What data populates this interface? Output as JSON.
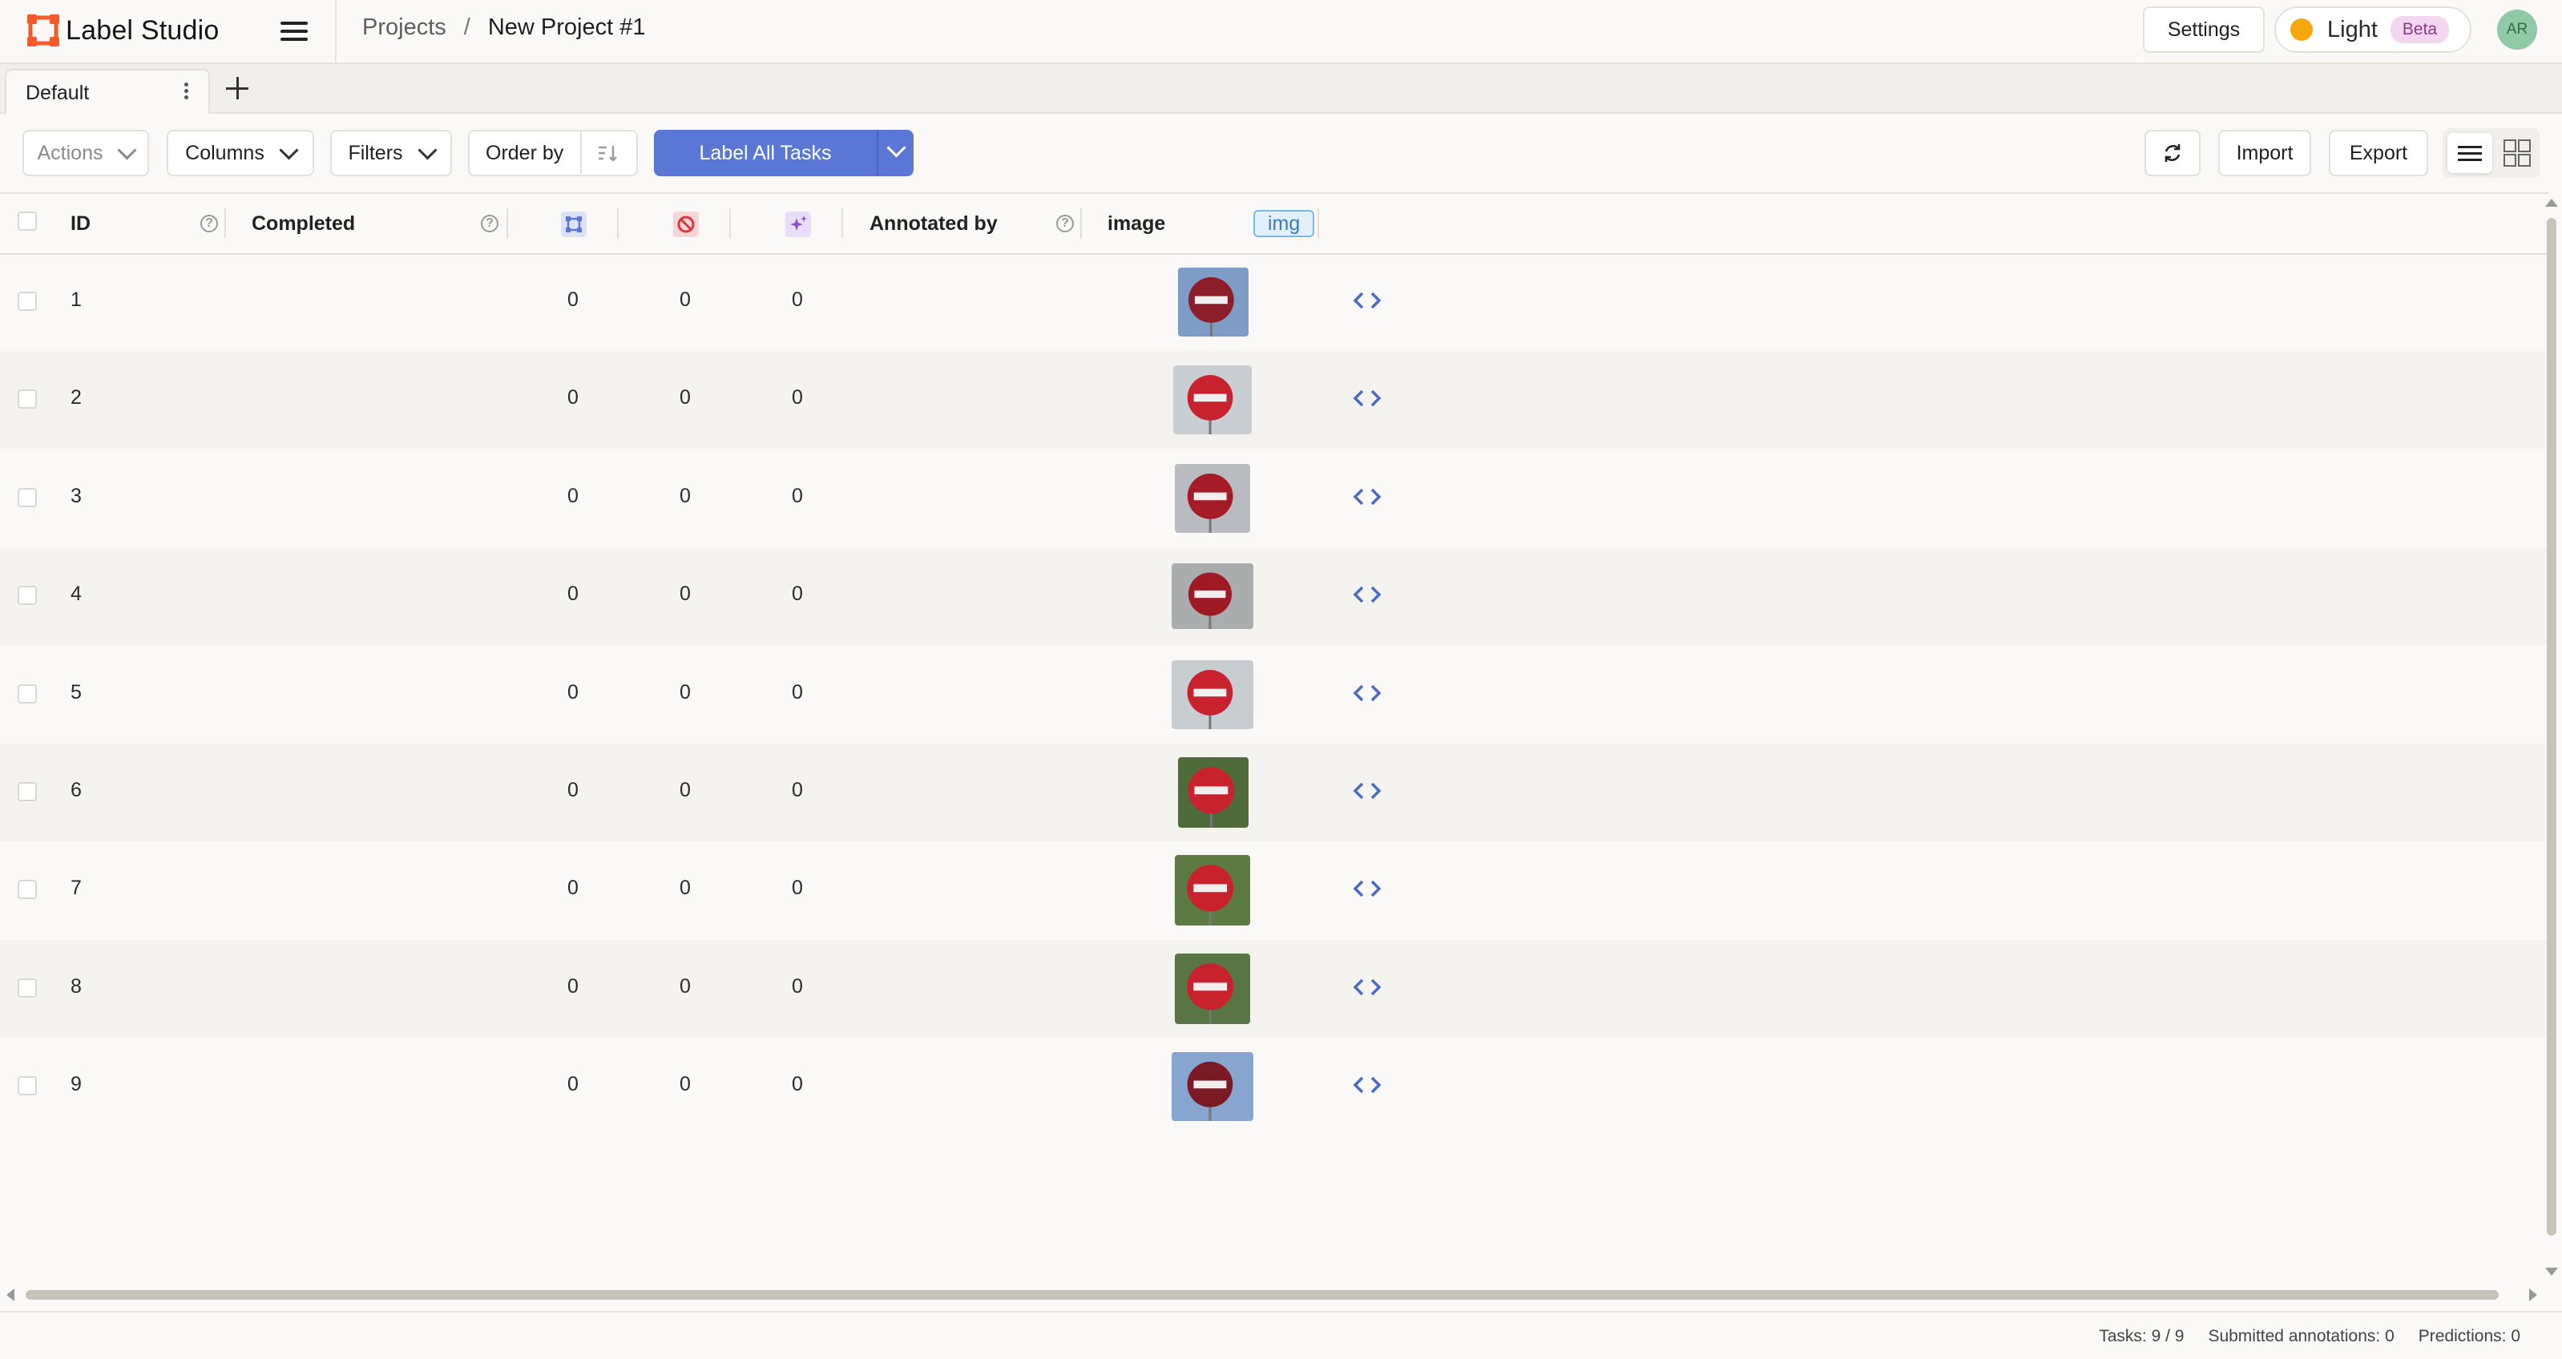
{
  "app": {
    "logo_text": "Label Studio",
    "brand_color": "#F55A2A"
  },
  "header": {
    "breadcrumb_projects": "Projects",
    "breadcrumb_separator": "/",
    "breadcrumb_current": "New Project #1",
    "settings_label": "Settings",
    "theme_label": "Light",
    "beta_label": "Beta",
    "avatar_initials": "AR"
  },
  "tabs": [
    {
      "label": "Default",
      "active": true
    }
  ],
  "toolbar": {
    "actions_label": "Actions",
    "columns_label": "Columns",
    "filters_label": "Filters",
    "order_by_label": "Order by",
    "label_all_label": "Label All Tasks",
    "import_label": "Import",
    "export_label": "Export",
    "accent_color": "#5B77D6"
  },
  "table": {
    "columns": {
      "id": "ID",
      "completed": "Completed",
      "total_annotations_icon": "annotations-icon",
      "cancelled_icon": "cancelled-icon",
      "predictions_icon": "predictions-icon",
      "annotated_by": "Annotated by",
      "image": "image",
      "image_tag": "img"
    },
    "rows": [
      {
        "id": "1",
        "annotations": "0",
        "cancelled": "0",
        "predictions": "0"
      },
      {
        "id": "2",
        "annotations": "0",
        "cancelled": "0",
        "predictions": "0"
      },
      {
        "id": "3",
        "annotations": "0",
        "cancelled": "0",
        "predictions": "0"
      },
      {
        "id": "4",
        "annotations": "0",
        "cancelled": "0",
        "predictions": "0"
      },
      {
        "id": "5",
        "annotations": "0",
        "cancelled": "0",
        "predictions": "0"
      },
      {
        "id": "6",
        "annotations": "0",
        "cancelled": "0",
        "predictions": "0"
      },
      {
        "id": "7",
        "annotations": "0",
        "cancelled": "0",
        "predictions": "0"
      },
      {
        "id": "8",
        "annotations": "0",
        "cancelled": "0",
        "predictions": "0"
      },
      {
        "id": "9",
        "annotations": "0",
        "cancelled": "0",
        "predictions": "0"
      }
    ]
  },
  "footer": {
    "tasks": "Tasks: 9 / 9",
    "submitted": "Submitted annotations: 0",
    "predictions": "Predictions: 0"
  }
}
